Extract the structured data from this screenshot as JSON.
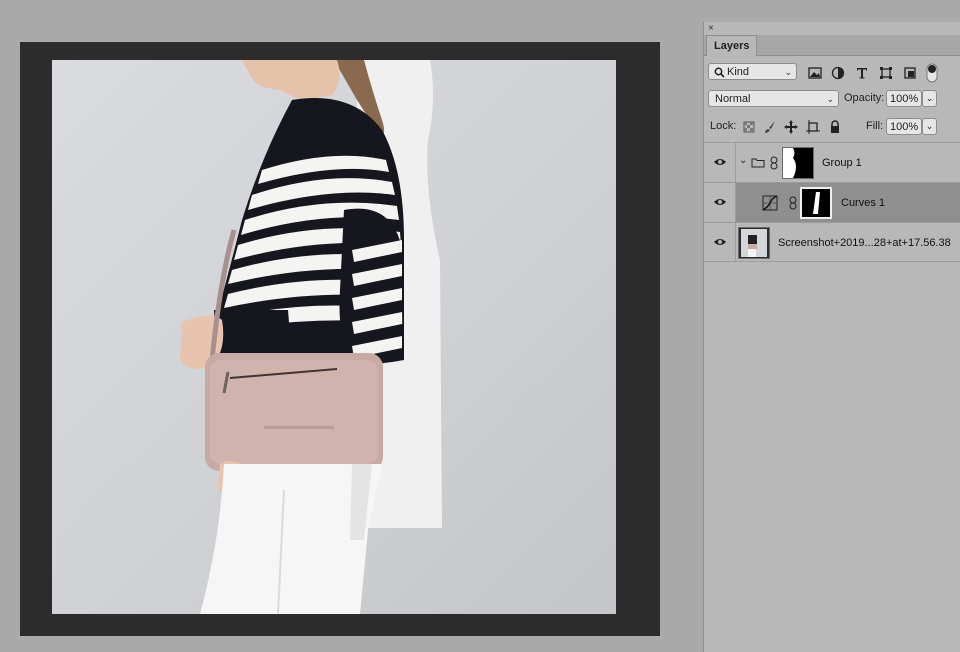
{
  "canvas": {
    "background_color": "#2c2c2c",
    "photo_description_color": "#cfd1d5"
  },
  "layers_panel": {
    "close_glyph": "×",
    "tab_label": "Layers",
    "filter": {
      "icon": "search-icon",
      "value": "Kind",
      "type_icons": [
        "image-filter-icon",
        "adjustment-filter-icon",
        "type-filter-icon",
        "shape-filter-icon",
        "smart-object-filter-icon",
        "filter-toggle-icon"
      ]
    },
    "blend_mode": "Normal",
    "opacity_label": "Opacity:",
    "opacity_value": "100%",
    "lock_label": "Lock:",
    "lock_icons": [
      "lock-transparent-icon",
      "lock-paint-icon",
      "lock-move-icon",
      "lock-artboard-icon",
      "lock-all-icon"
    ],
    "fill_label": "Fill:",
    "fill_value": "100%",
    "layers": [
      {
        "name": "Group 1",
        "type": "group",
        "visible": true,
        "expanded": true,
        "selected": false
      },
      {
        "name": "Curves 1",
        "type": "adjustment-curves",
        "visible": true,
        "selected": true
      },
      {
        "name": "Screenshot+2019...28+at+17.56.38",
        "type": "pixel",
        "visible": true,
        "selected": false
      }
    ],
    "colors": {
      "panel_bg": "#b8b8b8",
      "selected_row": "#8f8f8f"
    }
  }
}
